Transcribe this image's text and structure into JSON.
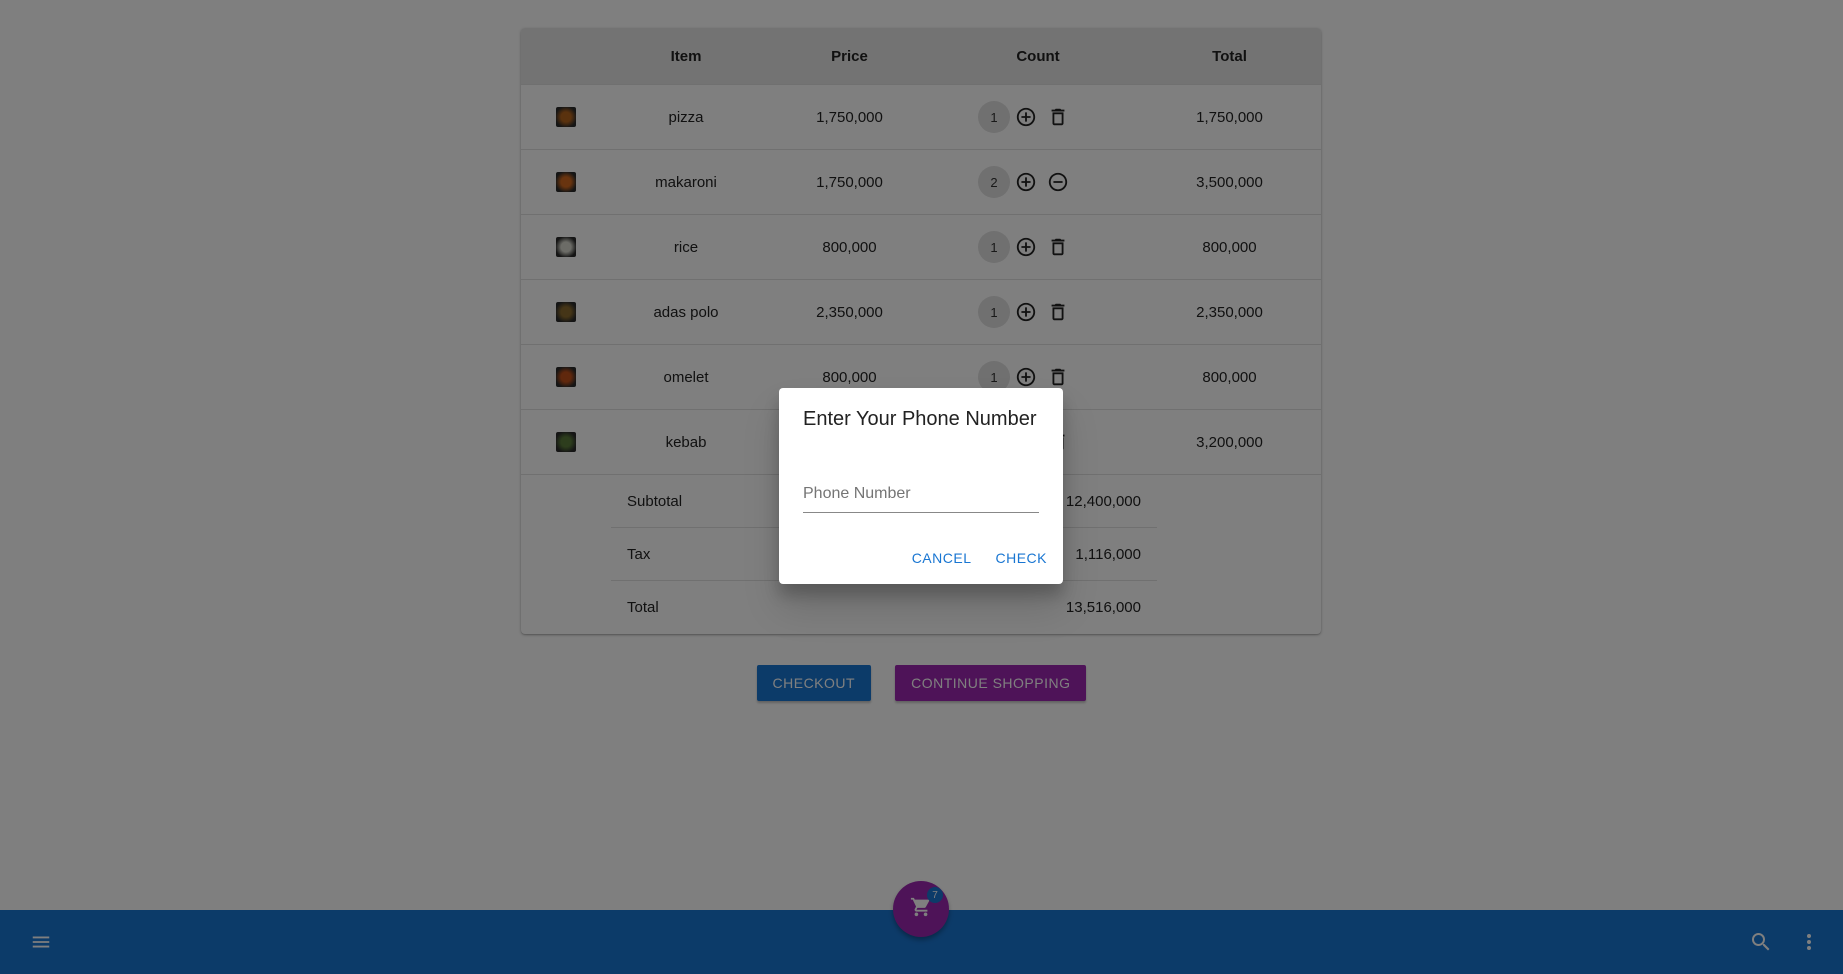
{
  "table": {
    "headers": {
      "image": "",
      "item": "Item",
      "price": "Price",
      "count": "Count",
      "total": "Total"
    },
    "rows": [
      {
        "name": "pizza",
        "price": "1,750,000",
        "count": "1",
        "total": "1,750,000",
        "thumb_color": "#b5651d",
        "remove_icon": "trash-icon"
      },
      {
        "name": "makaroni",
        "price": "1,750,000",
        "count": "2",
        "total": "3,500,000",
        "thumb_color": "#d2691e",
        "remove_icon": "minus-circle-icon"
      },
      {
        "name": "rice",
        "price": "800,000",
        "count": "1",
        "total": "800,000",
        "thumb_color": "#d9d9cf",
        "remove_icon": "trash-icon"
      },
      {
        "name": "adas polo",
        "price": "2,350,000",
        "count": "1",
        "total": "2,350,000",
        "thumb_color": "#8b6b2e",
        "remove_icon": "trash-icon"
      },
      {
        "name": "omelet",
        "price": "800,000",
        "count": "1",
        "total": "800,000",
        "thumb_color": "#c0501a",
        "remove_icon": "trash-icon"
      },
      {
        "name": "kebab",
        "price": "",
        "count": "",
        "total": "3,200,000",
        "thumb_color": "#5a7a3a",
        "remove_icon": "trash-icon"
      }
    ]
  },
  "summary": {
    "subtotal_label": "Subtotal",
    "subtotal_value": "12,400,000",
    "tax_label": "Tax",
    "tax_value": "1,116,000",
    "total_label": "Total",
    "total_value": "13,516,000"
  },
  "actions": {
    "checkout_label": "CHECKOUT",
    "continue_label": "CONTINUE SHOPPING"
  },
  "fab": {
    "icon": "cart-icon",
    "badge": "7"
  },
  "bottom_bar": {
    "menu_icon": "menu-icon",
    "search_icon": "search-icon",
    "more_icon": "more-vert-icon"
  },
  "dialog": {
    "title": "Enter Your Phone Number",
    "phone_placeholder": "Phone Number",
    "phone_value": "",
    "cancel_label": "CANCEL",
    "check_label": "CHECK"
  },
  "colors": {
    "primary": "#1976d2",
    "secondary": "#9c27b0",
    "overlay": "rgba(0,0,0,0.5)"
  }
}
